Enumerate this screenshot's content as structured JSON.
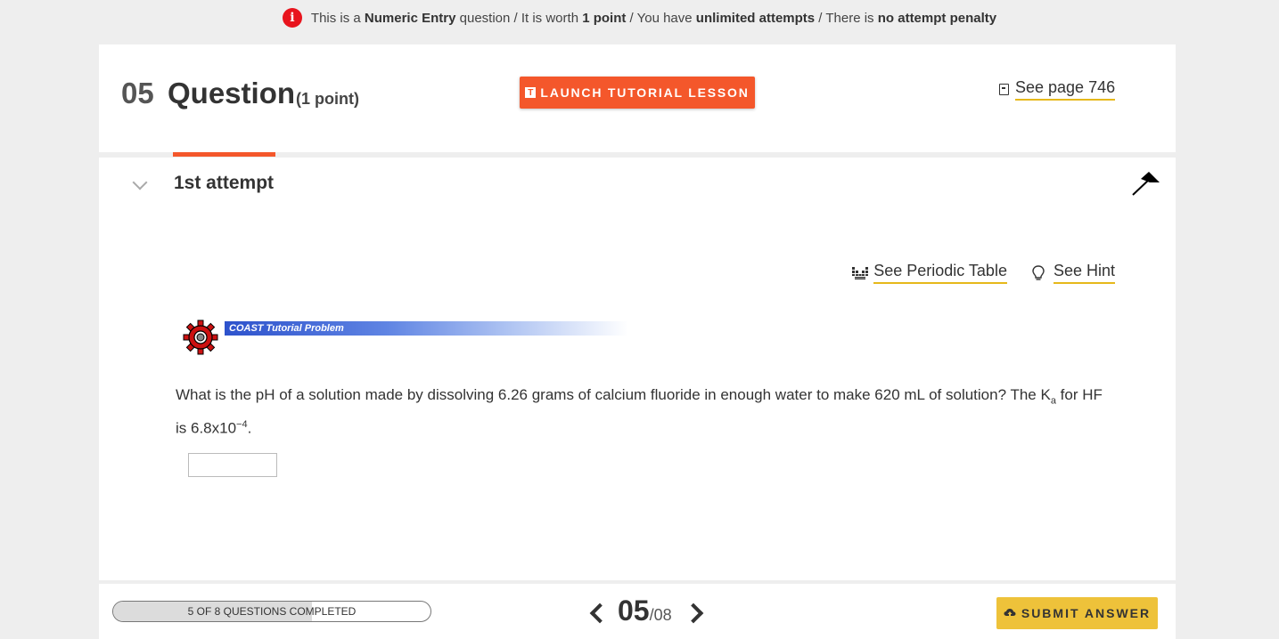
{
  "banner": {
    "t1": "This is a ",
    "b1": "Numeric Entry",
    "t2": " question / It is worth ",
    "b2": "1 point",
    "t3": " / You have ",
    "b3": "unlimited attempts",
    "t4": " / There is ",
    "b4": "no attempt penalty"
  },
  "header": {
    "number": "05",
    "title": "Question",
    "points": "(1 point)",
    "launch_label": "LAUNCH TUTORIAL LESSON",
    "page_ref": "See page 746"
  },
  "attempt": {
    "title": "1st attempt",
    "periodic_table": "See Periodic Table",
    "hint": "See Hint",
    "coast_label": "COAST Tutorial Problem",
    "q_part1": "What is the pH of a solution made by dissolving 6.26 grams of calcium fluoride in enough water to make 620 mL of solution? The K",
    "q_sub": "a",
    "q_part2": " for HF is 6.8x10",
    "q_sup": "−4",
    "q_part3": ".",
    "answer_value": ""
  },
  "footer": {
    "progress_text": "5 OF 8 QUESTIONS COMPLETED",
    "progress_completed": 5,
    "progress_total": 8,
    "page_current": "05",
    "page_total": "/08",
    "submit_label": "SUBMIT ANSWER"
  },
  "colors": {
    "accent": "#f4572b",
    "highlight": "#e6b81b",
    "submit": "#eec23a",
    "info": "#e8141d"
  },
  "icons": [
    "info-icon",
    "t-icon",
    "book-icon",
    "chevron-down-icon",
    "arrow-icon",
    "periodic-table-icon",
    "lightbulb-icon",
    "gear-icon",
    "chevron-left-icon",
    "chevron-right-icon",
    "cloud-upload-icon"
  ]
}
